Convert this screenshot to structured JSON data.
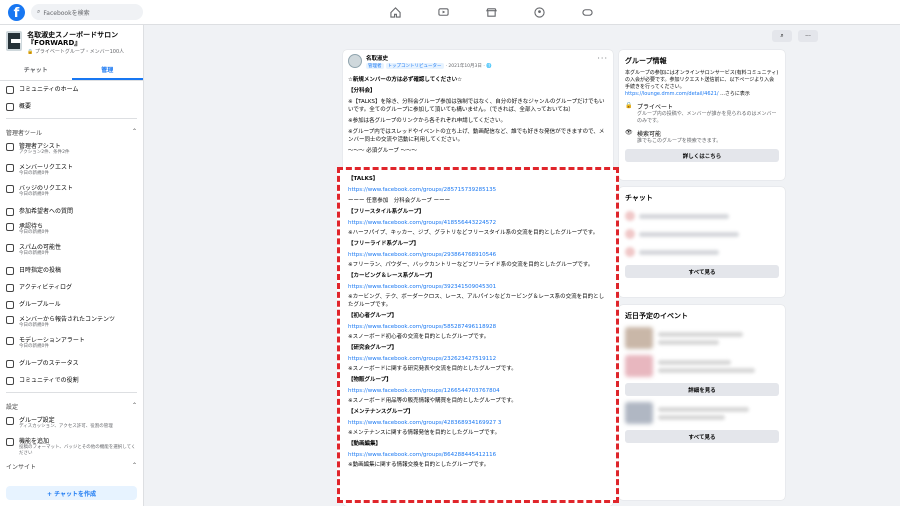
{
  "topbar": {
    "logo": "f",
    "search_placeholder": "Facebookを検索",
    "icons": [
      "home-icon",
      "video-icon",
      "marketplace-icon",
      "groups-icon",
      "gaming-icon"
    ]
  },
  "sidebar": {
    "group_name": "名取淑史スノーボードサロン『FORWARD』",
    "group_meta": "🔒 プライベートグループ・メンバー100人",
    "tabs": [
      "チャット",
      "管理"
    ],
    "top_items": [
      {
        "label": "コミュニティのホーム",
        "icon": "home-icon"
      },
      {
        "label": "概要",
        "icon": "overview-icon"
      }
    ],
    "admin_section": "管理者ツール",
    "admin_items": [
      {
        "label": "管理者アシスト",
        "sub": "アクション2件、条件2件",
        "icon": "assist-icon"
      },
      {
        "label": "メンバーリクエスト",
        "sub": "今日の新規0件",
        "icon": "member-request-icon"
      },
      {
        "label": "バッジのリクエスト",
        "sub": "今日の新規0件",
        "icon": "badge-icon"
      },
      {
        "label": "参加希望者への質問",
        "sub": "",
        "icon": "questions-icon"
      },
      {
        "label": "承認待ち",
        "sub": "今日の新規0件",
        "icon": "pending-icon"
      },
      {
        "label": "スパムの可能性",
        "sub": "今日の新規0件",
        "icon": "spam-icon"
      },
      {
        "label": "日時指定の投稿",
        "sub": "",
        "icon": "schedule-icon"
      },
      {
        "label": "アクティビティログ",
        "sub": "",
        "icon": "log-icon"
      },
      {
        "label": "グループルール",
        "sub": "",
        "icon": "rules-icon"
      },
      {
        "label": "メンバーから報告されたコンテンツ",
        "sub": "今日の新規0件",
        "icon": "report-icon"
      },
      {
        "label": "モデレーションアラート",
        "sub": "今日の新規0件",
        "icon": "alert-icon"
      },
      {
        "label": "グループのステータス",
        "sub": "",
        "icon": "status-icon"
      },
      {
        "label": "コミュニティでの役割",
        "sub": "",
        "icon": "roles-icon"
      }
    ],
    "settings_section": "設定",
    "settings_items": [
      {
        "label": "グループ設定",
        "sub": "ディスカッション、アクセス許可、役割の管理",
        "icon": "settings-icon"
      },
      {
        "label": "機能を追加",
        "sub": "投稿のフォーマット、バッジとその他の機能を選択してください",
        "icon": "add-feature-icon"
      }
    ],
    "insights_section": "インサイト",
    "create_chat": "+ チャットを作成"
  },
  "toolbar": {
    "search_icon": "search-icon",
    "more_label": "···"
  },
  "post": {
    "author": "名取淑史",
    "badge_admin": "管理者",
    "badge_contrib": "トップコントリビューター",
    "date": "· 2021年10月3日 · 🌐",
    "more": "···",
    "lines": [
      {
        "t": "☆新規メンバーの方は必ず確認してください☆",
        "b": true
      },
      {
        "t": "【分科会】",
        "b": true
      },
      {
        "t": "※【TALKS】を除き、分科会グループ参加は強制ではなく、自分の好きなジャンルのグループだけでもいいです。全てのグループに参加して頂いても構いません。（できれば、全部入っておいてね）",
        "b": false
      },
      {
        "t": "※参加は各グループのリンクから各それぞれ申請してください。",
        "b": false
      },
      {
        "t": "※グループ内ではスレッドやイベントの立ち上げ、動画配信など、誰でも好きな発信ができますので、メンバー同士の交流や活動に利用してください。",
        "b": false
      },
      {
        "t": "～～～ 必須グループ ～～～",
        "b": false
      }
    ]
  },
  "links_box": {
    "rows": [
      {
        "k": "h",
        "t": "【TALKS】"
      },
      {
        "k": "l",
        "t": "https://www.facebook.com/groups/285715739285135"
      },
      {
        "k": "n",
        "t": "ーーー 任意参加　分科会グループ ーーー"
      },
      {
        "k": "h",
        "t": "【フリースタイル系グループ】"
      },
      {
        "k": "l",
        "t": "https://www.facebook.com/groups/418556443224572"
      },
      {
        "k": "d",
        "t": "※ハーフパイプ、キッカー、ジブ、グラトリなどフリースタイル系の交流を目的としたグループです。"
      },
      {
        "k": "h",
        "t": "【フリーライド系グループ】"
      },
      {
        "k": "l",
        "t": "https://www.facebook.com/groups/293864768910546"
      },
      {
        "k": "d",
        "t": "※フリーラン、パウダー、バックカントリーなどフリーライド系の交流を目的としたグループです。"
      },
      {
        "k": "h",
        "t": "【カービング＆レース系グループ】"
      },
      {
        "k": "l",
        "t": "https://www.facebook.com/groups/392341509045301"
      },
      {
        "k": "d",
        "t": "※カービング、テク、ボーダークロス、レース、アルパインなどカービング＆レース系の交流を目的としたグループです。"
      },
      {
        "k": "h",
        "t": "【初心者グループ】"
      },
      {
        "k": "l",
        "t": "https://www.facebook.com/groups/585287496118928"
      },
      {
        "k": "d",
        "t": "※スノーボード初心者の交流を目的としたグループです。"
      },
      {
        "k": "h",
        "t": "【研究会グループ】"
      },
      {
        "k": "l",
        "t": "https://www.facebook.com/groups/232623427519112"
      },
      {
        "k": "d",
        "t": "※スノーボードに関する研究発表や交流を目的としたグループです。"
      },
      {
        "k": "h",
        "t": "【物販グループ】"
      },
      {
        "k": "l",
        "t": "https://www.facebook.com/groups/1266544703767804"
      },
      {
        "k": "d",
        "t": "※スノーボード用品等の販売情報や購買を目的としたグループです。"
      },
      {
        "k": "h",
        "t": "【メンテナンスグループ】"
      },
      {
        "k": "l",
        "t": "https://www.facebook.com/groups/428368934169927 3"
      },
      {
        "k": "d",
        "t": "※メンテナンスに関する情報発信を目的としたグループです。"
      },
      {
        "k": "h",
        "t": "【動画編集】"
      },
      {
        "k": "l",
        "t": "https://www.facebook.com/groups/864288445412116"
      },
      {
        "k": "d",
        "t": "※動画編集に関する情報交換を目的としたグループです。"
      }
    ]
  },
  "group_info": {
    "title": "グループ情報",
    "desc": "本グループの参加にはオンラインサロンサービス(有料コミュニティ)の入会が必要です。参加リクエスト送信前に、以下ページより入会手続きを行ってください。",
    "link": "https://lounge.dmm.com/detail/4621/",
    "see_more": "...さらに表示",
    "private_title": "プライベート",
    "private_sub": "グループ内の投稿や、メンバーが誰かを見られるのはメンバーのみです。",
    "visible_title": "検索可能",
    "visible_sub": "誰でもこのグループを検索できます。",
    "details_btn": "詳しくはこちら"
  },
  "chat_card": {
    "title": "チャット",
    "see_all": "すべて見る"
  },
  "events_card": {
    "title": "近日予定のイベント",
    "details_btn": "詳細を見る",
    "see_all": "すべて見る"
  },
  "colors": {
    "accent": "#1877f2",
    "highlight": "#e0252b"
  }
}
